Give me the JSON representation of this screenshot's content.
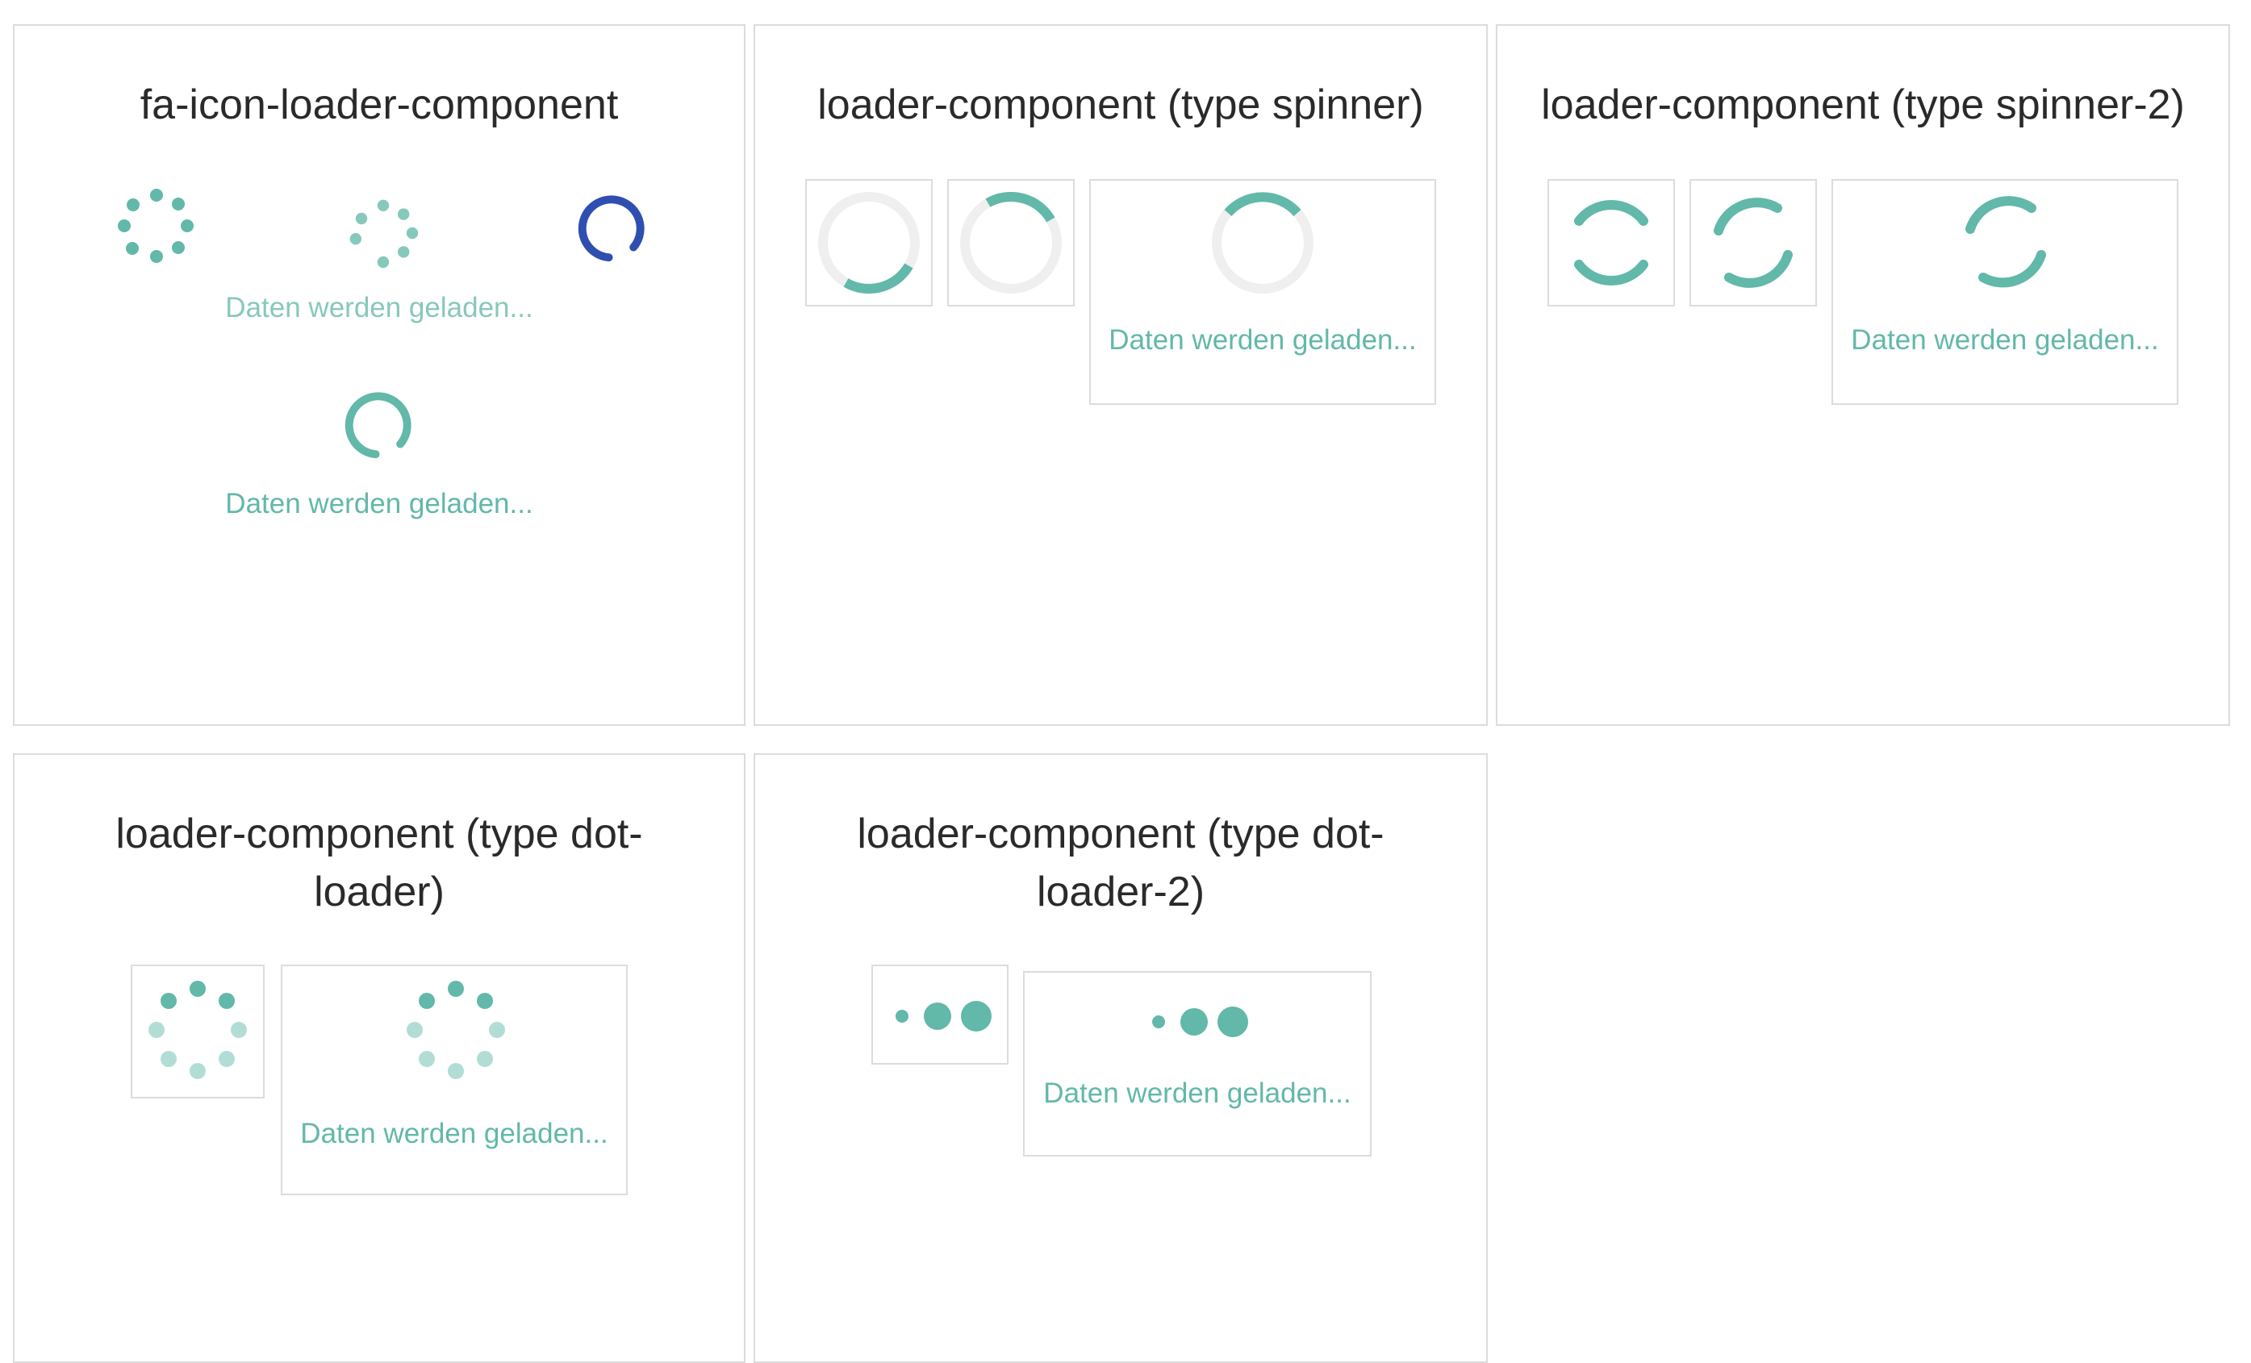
{
  "colors": {
    "accent": "#62b8a9",
    "accent_light": "#87c8bc",
    "accent_faint": "#b2ddd6",
    "track": "#efefef",
    "blue": "#2f4fb0",
    "border": "#dcdcdc"
  },
  "panels": [
    {
      "title": "fa-icon-loader-component",
      "loading_text_1": "Daten werden geladen...",
      "loading_text_2": "Daten werden geladen..."
    },
    {
      "title": "loader-component (type spinner)",
      "loading_text": "Daten werden geladen..."
    },
    {
      "title": "loader-component (type spinner-2)",
      "loading_text": "Daten werden geladen..."
    },
    {
      "title_line1": "loader-component (type dot-",
      "title_line2": "loader)",
      "loading_text": "Daten werden geladen..."
    },
    {
      "title_line1": "loader-component (type dot-",
      "title_line2": "loader-2)",
      "loading_text": "Daten werden geladen..."
    }
  ],
  "icons": {
    "dot_spinner": "spinner-dots-icon",
    "ring_spinner": "circle-notch-icon",
    "arc_spinner": "spinner-arc-icon",
    "bouncing_dots": "three-dots-icon"
  }
}
